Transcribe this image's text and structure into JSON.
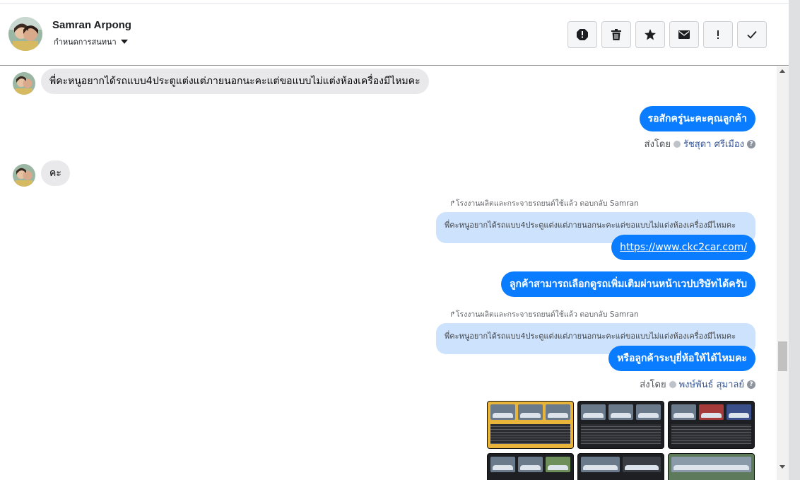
{
  "header": {
    "name": "Samran Arpong",
    "assign_label": "กำหนดการสนทนา",
    "actions": [
      "report-icon",
      "trash-icon",
      "star-icon",
      "mail-icon",
      "exclamation-icon",
      "check-icon"
    ]
  },
  "messages": {
    "m1": "พี่คะหนูอยากได้รถแบบ4ประตูแต่งแต่ภายนอกนะคะแต่ขอแบบไม่แต่งห้องเครื่องมีไหมคะ",
    "m2": "รอสักครู่นะคะคุณลูกค้า",
    "m2_sent_prefix": "ส่งโดย",
    "m2_agent": "รัชสุดา ศรีเมือง",
    "m3": "คะ",
    "reply1_label": "โรงงานผลิตและกระจายรถยนต์ใช้แล้ว ตอบกลับ Samran",
    "reply1_quote": "พี่คะหนูอยากได้รถแบบ4ประตูแต่งแต่ภายนอกนะคะแต่ขอแบบไม่แต่งห้องเครื่องมีไหมคะ",
    "m4_link": "https://www.ckc2car.com/",
    "m5": "ลูกค้าสามารถเลือกดูรถเพิ่มเติมผ่านหน้าเวปบริษัทได้ครับ",
    "reply2_label": "โรงงานผลิตและกระจายรถยนต์ใช้แล้ว ตอบกลับ Samran",
    "reply2_quote": "พี่คะหนูอยากได้รถแบบ4ประตูแต่งแต่ภายนอกนะคะแต่ขอแบบไม่แต่งห้องเครื่องมีไหมคะ",
    "m6": "หรือลูกค้าระบุยี่ห้อให้ได้ไหมคะ",
    "m6_sent_prefix": "ส่งโดย",
    "m6_agent": "พงษ์พันธ์ สุมาลย์"
  },
  "colors": {
    "outgoing": "#0a7cff",
    "incoming": "#e9e9eb",
    "quote": "#cde2fc"
  }
}
